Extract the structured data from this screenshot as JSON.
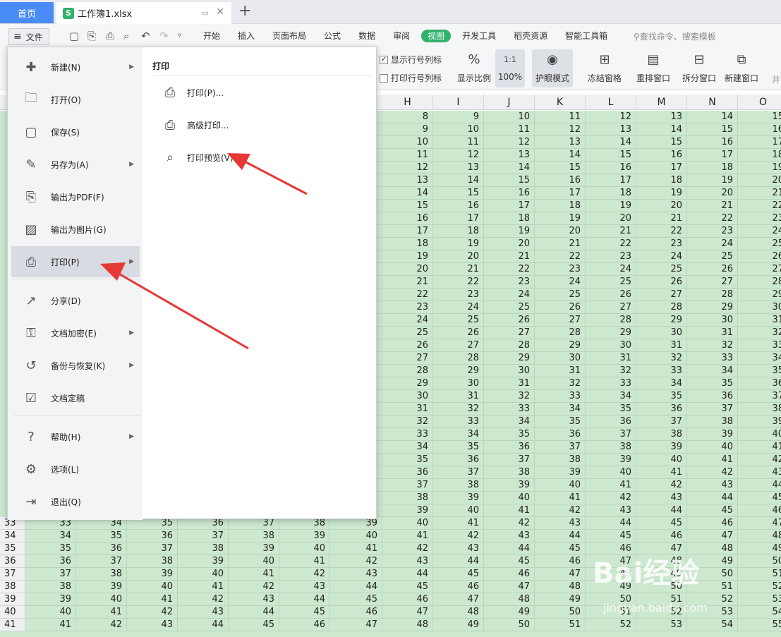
{
  "titlebar": {
    "home_tab": "首页",
    "doc_icon": "S",
    "doc_tab": "工作簿1.xlsx",
    "new_tab": "+"
  },
  "menubar": {
    "file": "文件",
    "tabs": [
      "开始",
      "插入",
      "页面布局",
      "公式",
      "数据",
      "审阅",
      "视图",
      "开发工具",
      "稻壳资源",
      "智能工具箱"
    ],
    "active_tab": "视图",
    "search_placeholder": "查找命令、搜索模板"
  },
  "ribbon": {
    "show_headers": "显示行号列标",
    "print_headers": "打印行号列标",
    "zoom_ratio": "显示比例",
    "zoom_100": "100%",
    "eye_mode": "护眼模式",
    "freeze": "冻结窗格",
    "arrange": "重排窗口",
    "split": "拆分窗口",
    "new_window": "新建窗口",
    "partial_cut": "并"
  },
  "sheet": {
    "columns": [
      "H",
      "I",
      "J",
      "K",
      "L",
      "M",
      "N",
      "O"
    ],
    "row_numbers": [
      "33",
      "34",
      "35",
      "36",
      "37",
      "38",
      "39",
      "40",
      "41"
    ]
  },
  "file_menu": {
    "items": [
      {
        "label": "新建(N)",
        "icon": "new-file-icon",
        "arrow": true
      },
      {
        "label": "打开(O)",
        "icon": "folder-icon",
        "arrow": false
      },
      {
        "label": "保存(S)",
        "icon": "save-icon",
        "arrow": false
      },
      {
        "label": "另存为(A)",
        "icon": "save-as-icon",
        "arrow": true
      },
      {
        "label": "输出为PDF(F)",
        "icon": "pdf-icon",
        "arrow": false
      },
      {
        "label": "输出为图片(G)",
        "icon": "image-icon",
        "arrow": false
      },
      {
        "label": "打印(P)",
        "icon": "printer-icon",
        "arrow": true
      },
      {
        "label": "分享(D)",
        "icon": "share-icon",
        "arrow": false
      },
      {
        "label": "文档加密(E)",
        "icon": "lock-doc-icon",
        "arrow": true
      },
      {
        "label": "备份与恢复(K)",
        "icon": "backup-icon",
        "arrow": true
      },
      {
        "label": "文档定稿",
        "icon": "finalize-icon",
        "arrow": false
      },
      {
        "label": "帮助(H)",
        "icon": "help-icon",
        "arrow": true
      },
      {
        "label": "选项(L)",
        "icon": "gear-icon",
        "arrow": false
      },
      {
        "label": "退出(Q)",
        "icon": "exit-icon",
        "arrow": false
      }
    ],
    "submenu_title": "打印",
    "submenu": [
      {
        "label": "打印(P)...",
        "icon": "printer-icon"
      },
      {
        "label": "高级打印...",
        "icon": "advanced-print-icon"
      },
      {
        "label": "打印预览(V)",
        "icon": "print-preview-icon"
      }
    ]
  },
  "watermark": {
    "text": "Bai经验",
    "sub": "jingyan.baidu.com"
  },
  "colors": {
    "accent": "#2fb26a",
    "home_tab": "#4a8cf7",
    "sheet_bg": "#cce8cf",
    "arrow": "#e53935"
  }
}
